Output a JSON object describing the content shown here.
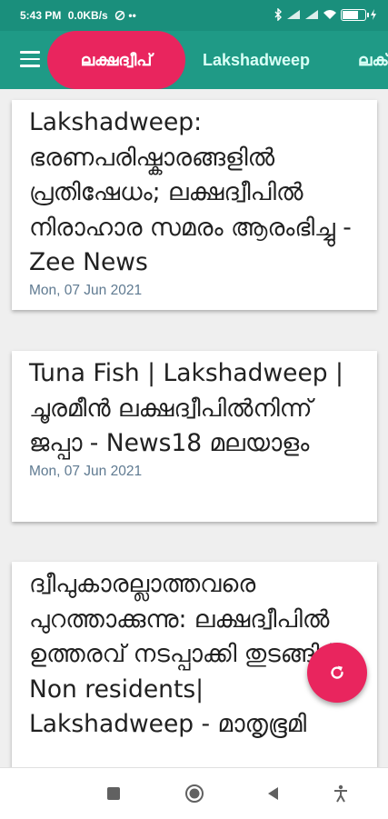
{
  "status_bar": {
    "time": "5:43 PM",
    "net_speed": "0.0KB/s",
    "battery_level": 0.72
  },
  "app_bar": {
    "tabs": [
      {
        "label": "ലക്ഷദ്വീപ്",
        "active": true
      },
      {
        "label": "Lakshadweep",
        "active": false
      },
      {
        "label": "ലക്",
        "active": false
      }
    ],
    "accent": "#e9255e",
    "bar_color": "#1f9a86"
  },
  "articles": [
    {
      "title": "Lakshadweep: ഭരണപരിഷ്കാരങ്ങളിൽ പ്രതിഷേധം; ലക്ഷദ്വീപിൽ നിരാഹാര സമരം ആരംഭിച്ചു - Zee News",
      "date": "Mon, 07 Jun 2021"
    },
    {
      "title": "Tuna Fish | Lakshadweep | ചൂരമീൻ ലക്ഷദ്വീപിൽനിന്ന് ജപ്പാ - News18 മലയാളം",
      "date": "Mon, 07 Jun 2021"
    },
    {
      "title": "ദ്വീപുകാരല്ലാത്തവരെ പുറത്താക്കുന്നു: ലക്ഷദ്വീപിൽ ഉത്തരവ് നടപ്പാക്കി തുടങ്ങി | Non residents| Lakshadweep - മാതൃഭൂമി",
      "date": ""
    }
  ],
  "fab": {
    "icon": "refresh-icon"
  },
  "nav": {
    "icons": [
      "recent-apps-icon",
      "home-icon",
      "back-icon",
      "accessibility-icon"
    ]
  }
}
